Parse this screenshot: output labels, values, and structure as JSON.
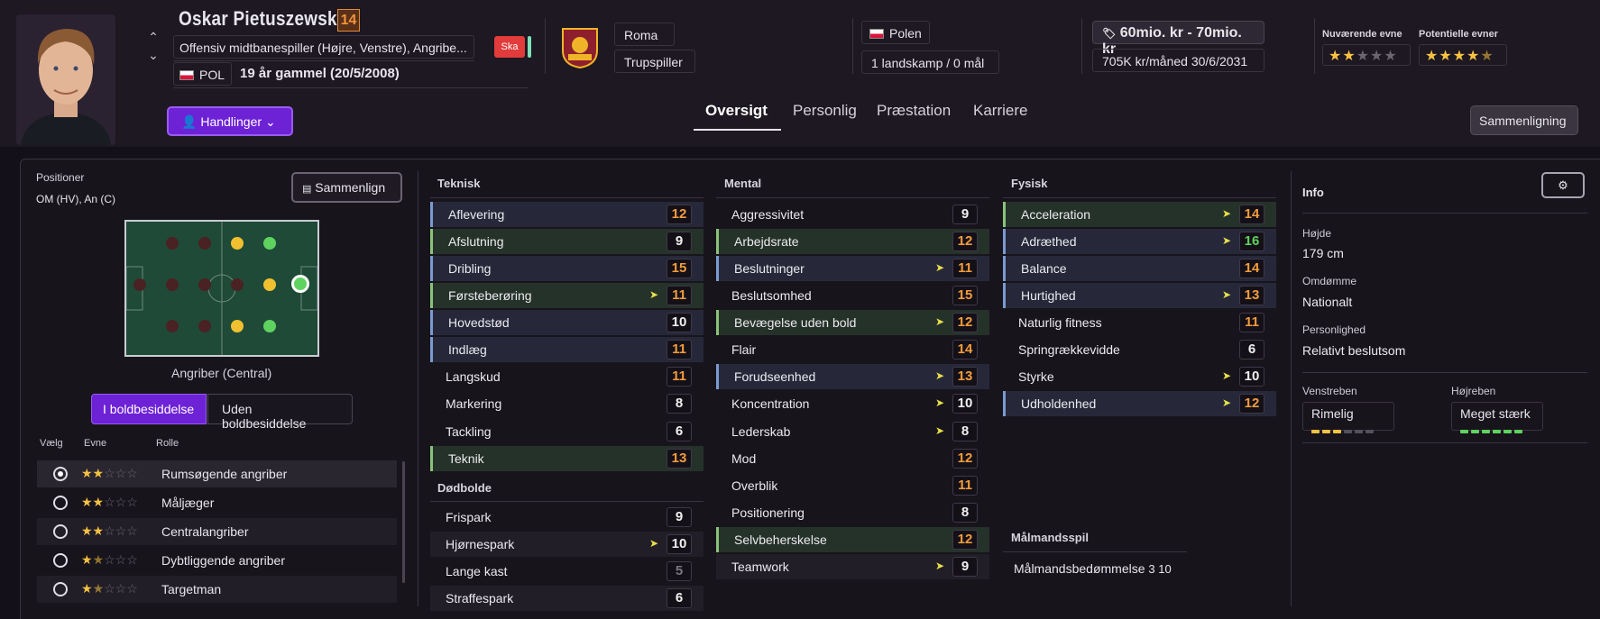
{
  "header": {
    "player_name": "Oskar Pietuszewski",
    "ca_badge": "14",
    "position_text": "Offensiv midtbanespiller (Højre, Venstre), Angribe...",
    "nationality_code": "POL",
    "age_text": "19 år gammel (20/5/2008)",
    "injury_badge": "Ska",
    "club": "Roma",
    "squad_status": "Trupspiller",
    "country": "Polen",
    "caps": "1 landskamp / 0 mål",
    "value": "60mio. kr - 70mio. kr",
    "wage": "705K kr/måned",
    "contract": "30/6/2031",
    "current_ability_label": "Nuværende evne",
    "potential_ability_label": "Potentielle evner",
    "current_ability_stars": "★★☆☆☆",
    "potential_ability_stars": "★★★★☆"
  },
  "actions_button": "Handlinger",
  "tabs": [
    "Oversigt",
    "Personlig",
    "Præstation",
    "Karriere"
  ],
  "compare_button": "Sammenligning",
  "positions": {
    "label": "Positioner",
    "value": "OM (HV), An (C)",
    "compare_button": "Sammenlign",
    "pitch_role": "Angriber (Central)"
  },
  "toggle": {
    "in_possession": "I boldbesiddelse",
    "out_of_possession": "Uden boldbesiddelse"
  },
  "roles": {
    "headers": {
      "select": "Vælg",
      "ability": "Evne",
      "role": "Rolle"
    },
    "items": [
      {
        "name": "Rumsøgende angriber",
        "stars": 2,
        "selected": true
      },
      {
        "name": "Måljæger",
        "stars": 2,
        "selected": false
      },
      {
        "name": "Centralangriber",
        "stars": 2,
        "selected": false
      },
      {
        "name": "Dybtliggende angriber",
        "stars": 1.5,
        "selected": false
      },
      {
        "name": "Targetman",
        "stars": 1.5,
        "selected": false
      }
    ]
  },
  "technical": {
    "title": "Teknisk",
    "attributes": [
      {
        "name": "Aflevering",
        "value": "12"
      },
      {
        "name": "Afslutning",
        "value": "9"
      },
      {
        "name": "Dribling",
        "value": "15"
      },
      {
        "name": "Førsteberøring",
        "value": "11"
      },
      {
        "name": "Hovedstød",
        "value": "10"
      },
      {
        "name": "Indlæg",
        "value": "11"
      },
      {
        "name": "Langskud",
        "value": "11"
      },
      {
        "name": "Markering",
        "value": "8"
      },
      {
        "name": "Tackling",
        "value": "6"
      },
      {
        "name": "Teknik",
        "value": "13"
      }
    ]
  },
  "set_pieces": {
    "title": "Dødbolde",
    "attributes": [
      {
        "name": "Frispark",
        "value": "9"
      },
      {
        "name": "Hjørnespark",
        "value": "10"
      },
      {
        "name": "Lange kast",
        "value": "5"
      },
      {
        "name": "Straffespark",
        "value": "6"
      }
    ]
  },
  "mental": {
    "title": "Mental",
    "attributes": [
      {
        "name": "Aggressivitet",
        "value": "9"
      },
      {
        "name": "Arbejdsrate",
        "value": "12"
      },
      {
        "name": "Beslutninger",
        "value": "11"
      },
      {
        "name": "Beslutsomhed",
        "value": "15"
      },
      {
        "name": "Bevægelse uden bold",
        "value": "12"
      },
      {
        "name": "Flair",
        "value": "14"
      },
      {
        "name": "Forudseenhed",
        "value": "13"
      },
      {
        "name": "Koncentration",
        "value": "10"
      },
      {
        "name": "Lederskab",
        "value": "8"
      },
      {
        "name": "Mod",
        "value": "12"
      },
      {
        "name": "Overblik",
        "value": "11"
      },
      {
        "name": "Positionering",
        "value": "8"
      },
      {
        "name": "Selvbeherskelse",
        "value": "12"
      },
      {
        "name": "Teamwork",
        "value": "9"
      }
    ]
  },
  "physical": {
    "title": "Fysisk",
    "attributes": [
      {
        "name": "Acceleration",
        "value": "14"
      },
      {
        "name": "Adræthed",
        "value": "16"
      },
      {
        "name": "Balance",
        "value": "14"
      },
      {
        "name": "Hurtighed",
        "value": "13"
      },
      {
        "name": "Naturlig fitness",
        "value": "11"
      },
      {
        "name": "Springrækkevidde",
        "value": "6"
      },
      {
        "name": "Styrke",
        "value": "10"
      },
      {
        "name": "Udholdenhed",
        "value": "12"
      }
    ]
  },
  "goalkeeping": {
    "title": "Målmandsspil",
    "label": "Målmandsbedømmelse",
    "value": "3 10"
  },
  "info": {
    "title": "Info",
    "height_label": "Højde",
    "height": "179 cm",
    "reputation_label": "Omdømme",
    "reputation": "Nationalt",
    "personality_label": "Personlighed",
    "personality": "Relativt beslutsom",
    "left_foot_label": "Venstreben",
    "left_foot": "Rimelig",
    "left_foot_level": 3,
    "right_foot_label": "Højreben",
    "right_foot": "Meget stærk",
    "right_foot_level": 6
  },
  "colors": {
    "accent": "#6d22d6",
    "orange": "#f39c3c",
    "green": "#5fd35f",
    "gold": "#f5c242"
  }
}
